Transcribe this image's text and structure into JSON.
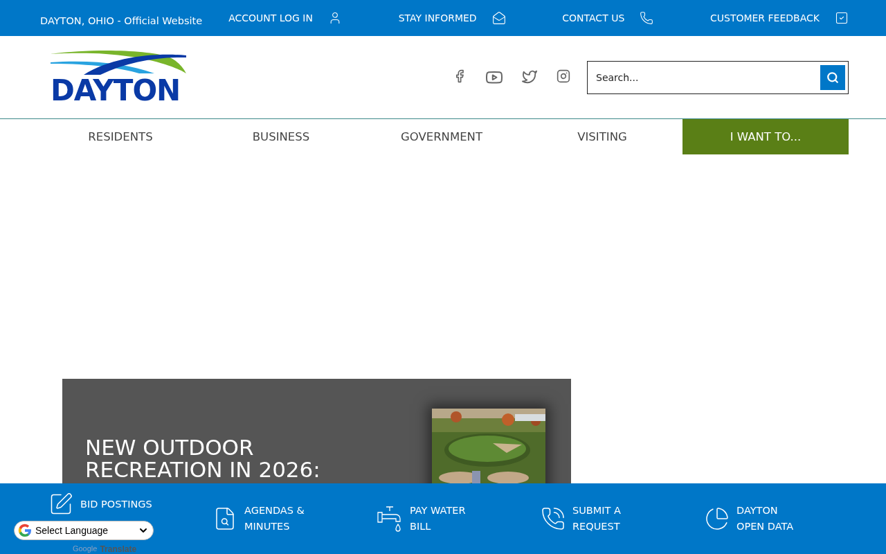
{
  "top_bar": {
    "site_label": "DAYTON, OHIO - Official Website",
    "links": [
      {
        "label": "ACCOUNT LOG IN"
      },
      {
        "label": "STAY INFORMED"
      },
      {
        "label": "CONTACT US"
      },
      {
        "label": "CUSTOMER FEEDBACK"
      }
    ]
  },
  "header": {
    "logo": {
      "text": "DAYTON"
    },
    "search": {
      "placeholder": "Search..."
    }
  },
  "nav": [
    {
      "label": "RESIDENTS",
      "highlighted": false
    },
    {
      "label": "BUSINESS",
      "highlighted": false
    },
    {
      "label": "GOVERNMENT",
      "highlighted": false
    },
    {
      "label": "VISITING",
      "highlighted": false
    },
    {
      "label": "I WANT TO...",
      "highlighted": true
    }
  ],
  "feature": {
    "title": "NEW OUTDOOR RECREATION IN 2026:"
  },
  "quick_links": [
    {
      "lines": [
        "BID POSTINGS"
      ]
    },
    {
      "lines": [
        "AGENDAS &",
        "MINUTES"
      ]
    },
    {
      "lines": [
        "PAY WATER",
        "BILL"
      ]
    },
    {
      "lines": [
        "SUBMIT A",
        "REQUEST"
      ]
    },
    {
      "lines": [
        "DAYTON",
        "OPEN DATA"
      ]
    }
  ],
  "translate": {
    "select_label": "Select Language",
    "brand": "Google",
    "label": "Translate"
  }
}
